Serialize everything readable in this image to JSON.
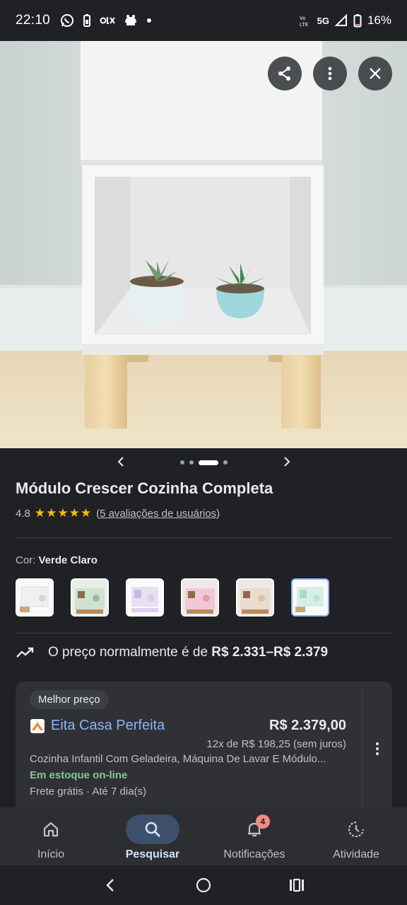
{
  "status_bar": {
    "time": "22:10",
    "network": "5G",
    "battery": "16%"
  },
  "hero": {
    "share_icon": "share-icon",
    "more_icon": "more-vert-icon",
    "close_icon": "close-icon"
  },
  "carousel": {
    "prev_icon": "chevron-left-icon",
    "next_icon": "chevron-right-icon",
    "dot_count": 4,
    "active_index": 2
  },
  "product": {
    "title": "Módulo Crescer Cozinha Completa",
    "rating": "4.8",
    "stars": "★★★★★",
    "reviews_prefix": "(",
    "reviews_link": "5 avaliações de usuários",
    "reviews_suffix": ")"
  },
  "color": {
    "label": "Cor:",
    "value": "Verde Claro",
    "selected_index": 5
  },
  "price_hint": {
    "text": "O preço normalmente é de ",
    "range": "R$ 2.331–R$ 2.379"
  },
  "offer": {
    "badge": "Melhor preço",
    "store": "Eita Casa Perfeita",
    "price": "R$ 2.379,00",
    "installments": "12x de R$ 198,25 (sem juros)",
    "description": "Cozinha Infantil Com Geladeira, Máquina De Lavar E Módulo...",
    "stock": "Em estoque on-line",
    "shipping": "Frete grátis · Até 7 dia(s)"
  },
  "bottom_nav": {
    "items": [
      {
        "label": "Início",
        "icon": "home-icon"
      },
      {
        "label": "Pesquisar",
        "icon": "search-icon"
      },
      {
        "label": "Notificações",
        "icon": "bell-icon",
        "badge": "4"
      },
      {
        "label": "Atividade",
        "icon": "activity-icon"
      }
    ]
  },
  "colors": {
    "accent": "#8ab4f8",
    "stock_green": "#81c995",
    "star": "#fbbc04",
    "background": "#202124"
  }
}
